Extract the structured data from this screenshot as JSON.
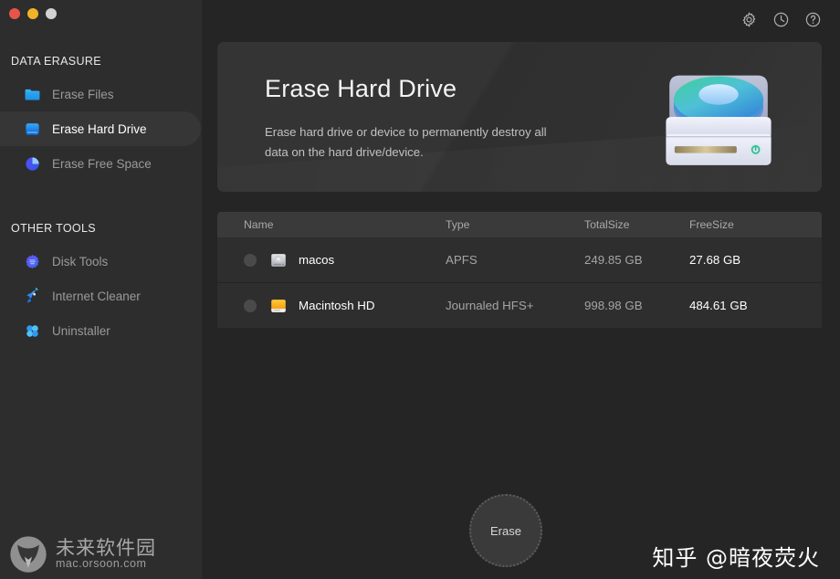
{
  "window": {
    "traffic_lights": [
      {
        "name": "close",
        "color": "#e8544a"
      },
      {
        "name": "minimize",
        "color": "#f0b429"
      },
      {
        "name": "maximize",
        "color": "#d2d2d2"
      }
    ]
  },
  "topbar": {
    "icons": [
      {
        "name": "gear-icon",
        "label": "Settings"
      },
      {
        "name": "history-icon",
        "label": "History"
      },
      {
        "name": "help-icon",
        "label": "Help"
      }
    ]
  },
  "sidebar": {
    "sections": [
      {
        "title": "DATA ERASURE",
        "items": [
          {
            "label": "Erase Files",
            "icon": "folder-icon",
            "active": false
          },
          {
            "label": "Erase Hard Drive",
            "icon": "harddrive-icon",
            "active": true
          },
          {
            "label": "Erase Free Space",
            "icon": "piechart-icon",
            "active": false
          }
        ]
      },
      {
        "title": "OTHER TOOLS",
        "items": [
          {
            "label": "Disk Tools",
            "icon": "disk-tools-icon",
            "active": false
          },
          {
            "label": "Internet Cleaner",
            "icon": "rocket-icon",
            "active": false
          },
          {
            "label": "Uninstaller",
            "icon": "four-dots-icon",
            "active": false
          }
        ]
      }
    ]
  },
  "banner": {
    "title": "Erase Hard Drive",
    "subtitle": "Erase hard drive or device to permanently destroy all data on the hard drive/device.",
    "art": "hard-drive-illustration"
  },
  "table": {
    "columns": [
      "Name",
      "Type",
      "TotalSize",
      "FreeSize"
    ],
    "rows": [
      {
        "selected": false,
        "icon": "disk-gray-icon",
        "name": "macos",
        "type": "APFS",
        "total_size": "249.85 GB",
        "free_size": "27.68 GB"
      },
      {
        "selected": false,
        "icon": "disk-orange-icon",
        "name": "Macintosh HD",
        "type": "Journaled HFS+",
        "total_size": "998.98 GB",
        "free_size": "484.61 GB"
      }
    ]
  },
  "actions": {
    "erase_label": "Erase"
  },
  "watermarks": {
    "orsoon_zh": "未来软件园",
    "orsoon_url": "mac.orsoon.com",
    "zhihu": "知乎 @暗夜荧火"
  },
  "colors": {
    "app_bg": "#252525",
    "sidebar_bg": "#2d2d2d",
    "card_bg": "#343434",
    "row_bg": "#2e2e2e",
    "header_bg": "#3a3a3a",
    "accent_blue": "#1a8cff",
    "accent_purple": "#5b4bf0",
    "text_primary": "#ffffff",
    "text_muted": "#9a9a9a"
  }
}
